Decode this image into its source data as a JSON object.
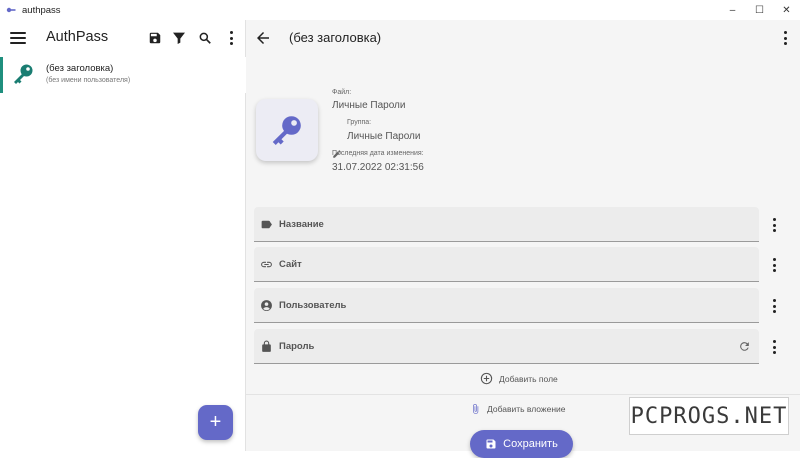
{
  "window": {
    "title": "authpass",
    "minimize": "–",
    "maximize": "☐",
    "close": "✕"
  },
  "left": {
    "app_name": "AuthPass",
    "entries": [
      {
        "title": "(без заголовка)",
        "subtitle": "(без имени пользователя)",
        "selected": true
      }
    ],
    "fab_label": "+"
  },
  "detail": {
    "title": "(без заголовка)",
    "file_label": "Файл:",
    "file_value": "Личные Пароли",
    "group_label": "Группа:",
    "group_value": "Личные Пароли",
    "modified_label": "Последняя дата изменения:",
    "modified_value": "31.07.2022 02:31:56",
    "fields": [
      {
        "label": "Название",
        "icon": "label-icon"
      },
      {
        "label": "Сайт",
        "icon": "link-icon"
      },
      {
        "label": "Пользователь",
        "icon": "account-icon"
      },
      {
        "label": "Пароль",
        "icon": "lock-icon",
        "trailing_icon": "refresh-icon"
      }
    ],
    "add_field": "Добавить поле",
    "add_attachment": "Добавить вложение",
    "save": "Сохранить"
  },
  "watermark": "PCPROGS.NET",
  "colors": {
    "accent": "#6469c8",
    "selection": "#1f8f7e",
    "key_teal": "#1a7d72",
    "panel_bg": "#f5f5f5",
    "field_bg": "#ececec"
  }
}
